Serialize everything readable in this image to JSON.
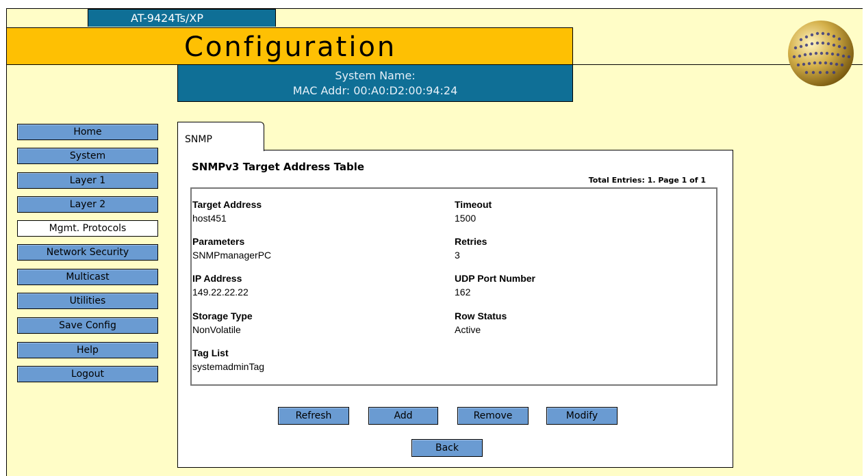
{
  "header": {
    "model": "AT-9424Ts/XP",
    "title": "Configuration",
    "system_name_line": "System Name:",
    "mac_line": "MAC Addr: 00:A0:D2:00:94:24"
  },
  "sidebar": {
    "items": [
      {
        "label": "Home"
      },
      {
        "label": "System"
      },
      {
        "label": "Layer 1"
      },
      {
        "label": "Layer 2"
      },
      {
        "label": "Mgmt. Protocols",
        "active": true
      },
      {
        "label": "Network Security"
      },
      {
        "label": "Multicast"
      },
      {
        "label": "Utilities"
      },
      {
        "label": "Save Config"
      },
      {
        "label": "Help"
      },
      {
        "label": "Logout"
      }
    ]
  },
  "tab": {
    "label": "SNMP"
  },
  "panel": {
    "title": "SNMPv3 Target Address Table",
    "totals": "Total Entries: 1. Page 1 of 1",
    "fields": {
      "target_address": {
        "label": "Target Address",
        "value": "host451"
      },
      "parameters": {
        "label": "Parameters",
        "value": "SNMPmanagerPC"
      },
      "ip_address": {
        "label": "IP Address",
        "value": "149.22.22.22"
      },
      "storage_type": {
        "label": "Storage Type",
        "value": "NonVolatile"
      },
      "tag_list": {
        "label": "Tag List",
        "value": "systemadminTag"
      },
      "timeout": {
        "label": "Timeout",
        "value": "1500"
      },
      "retries": {
        "label": "Retries",
        "value": "3"
      },
      "udp_port": {
        "label": "UDP Port Number",
        "value": "162"
      },
      "row_status": {
        "label": "Row Status",
        "value": "Active"
      }
    }
  },
  "actions": {
    "refresh": "Refresh",
    "add": "Add",
    "remove": "Remove",
    "modify": "Modify",
    "back": "Back"
  },
  "colors": {
    "background": "#fffdc7",
    "header_band": "#fec003",
    "info_bar": "#0f6f96",
    "button": "#6a9bd2",
    "active_nav": "#ffffff"
  },
  "icons": {
    "logo": "globe-logo-icon"
  }
}
